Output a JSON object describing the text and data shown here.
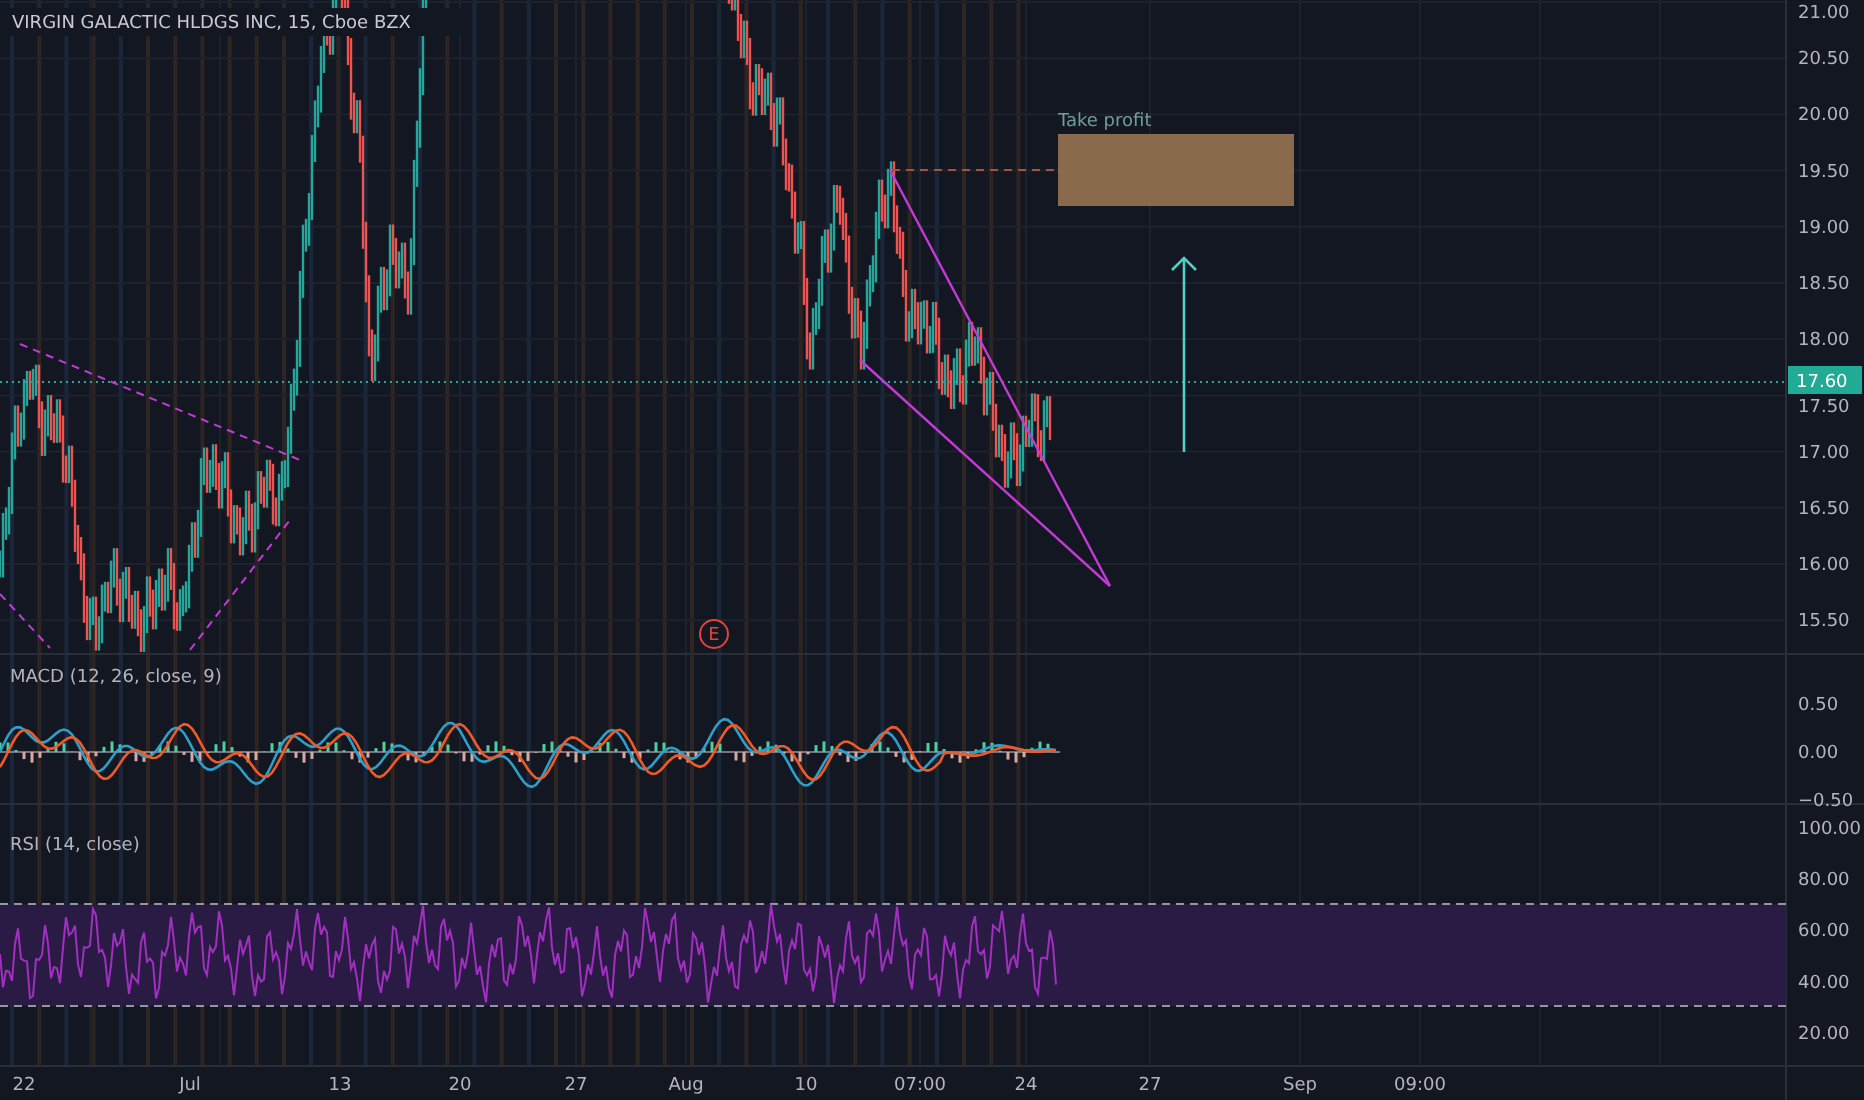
{
  "header": {
    "title": "VIRGIN GALACTIC HLDGS INC, 15, Cboe BZX"
  },
  "price_axis": [
    "21.00",
    "20.50",
    "20.00",
    "19.50",
    "19.00",
    "18.50",
    "18.00",
    "17.50",
    "17.00",
    "16.50",
    "16.00",
    "15.50"
  ],
  "last_price": "17.60",
  "annotations": {
    "take_profit": "Take profit",
    "earnings_marker": "E"
  },
  "indicators": [
    {
      "kind": "macd",
      "label": "MACD (12, 26, close, 9)",
      "axis": [
        "0.50",
        "0.00",
        "−0.50"
      ]
    },
    {
      "kind": "rsi",
      "label": "RSI (14, close)",
      "axis": [
        "100.00",
        "80.00",
        "60.00",
        "40.00",
        "20.00"
      ]
    }
  ],
  "time_axis": [
    "22",
    "Jul",
    "13",
    "20",
    "27",
    "Aug",
    "10",
    "07:00",
    "24",
    "27",
    "Sep",
    "09:00"
  ]
}
